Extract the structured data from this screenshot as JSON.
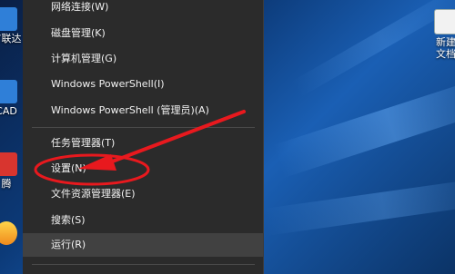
{
  "menu": {
    "items": [
      {
        "label": "网络连接(W)"
      },
      {
        "label": "磁盘管理(K)"
      },
      {
        "label": "计算机管理(G)"
      },
      {
        "label": "Windows PowerShell(I)"
      },
      {
        "label": "Windows PowerShell (管理员)(A)"
      },
      {
        "label": "任务管理器(T)"
      },
      {
        "label": "设置(N)"
      },
      {
        "label": "文件资源管理器(E)"
      },
      {
        "label": "搜索(S)"
      },
      {
        "label": "运行(R)"
      }
    ]
  },
  "desktop": {
    "left_icons": [
      {
        "label": "广联达",
        "icon": "glodon-app-icon"
      },
      {
        "label": "CAD",
        "icon": "cad-app-icon"
      },
      {
        "label": "腾",
        "icon": "tencent-app-icon"
      },
      {
        "label": "",
        "icon": "app-icon"
      }
    ],
    "right_icon": {
      "label_line1": "新建",
      "label_line2": "文档",
      "icon": "new-document-icon"
    }
  },
  "annotation": {
    "color": "#e8191e"
  }
}
